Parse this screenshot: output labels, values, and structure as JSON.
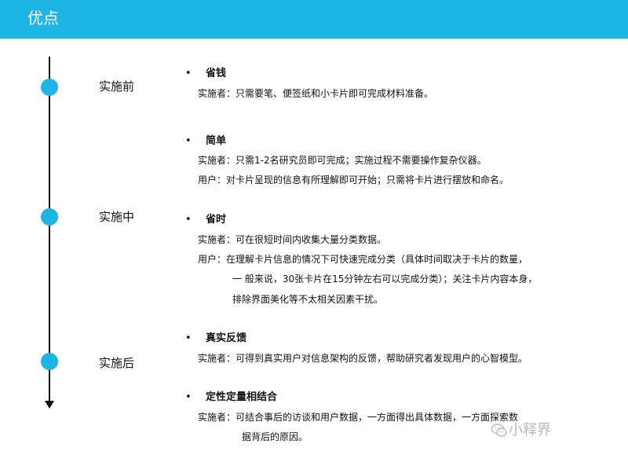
{
  "header": {
    "title": "优点",
    "color": "#1eb4e3"
  },
  "timeline": {
    "stages": [
      {
        "label": "实施前"
      },
      {
        "label": "实施中"
      },
      {
        "label": "实施后"
      }
    ]
  },
  "items": [
    {
      "bullet": "•",
      "title": "省钱",
      "lines": [
        "实施者：只需要笔、便签纸和小卡片即可完成材料准备。"
      ]
    },
    {
      "bullet": "•",
      "title": "简单",
      "lines": [
        "实施者：只需1-2名研究员即可完成；实施过程不需要操作复杂仪器。",
        "用户：对卡片呈现的信息有所理解即可开始；只需将卡片进行摆放和命名。"
      ]
    },
    {
      "bullet": "•",
      "title": "省时",
      "lines": [
        "实施者：可在很短时间内收集大量分类数据。",
        "用户：在理解卡片信息的情况下可快速完成分类（具体时间取决于卡片的数量，",
        "一 般来说，30张卡片在15分钟左右可以完成分类）；关注卡片内容本身，",
        "排除界面美化等不太相关因素干扰。"
      ]
    },
    {
      "bullet": "•",
      "title": "真实反馈",
      "lines": [
        "实施者：可得到真实用户对信息架构的反馈，帮助研究者发现用户的心智模型。"
      ]
    },
    {
      "bullet": "•",
      "title": "定性定量相结合",
      "lines": [
        "实施者：可结合事后的访谈和用户数据，一方面得出具体数据，一方面探索数",
        "据背后的原因。"
      ]
    }
  ],
  "watermark": {
    "text": "小释界",
    "icon": "wechat-icon"
  }
}
